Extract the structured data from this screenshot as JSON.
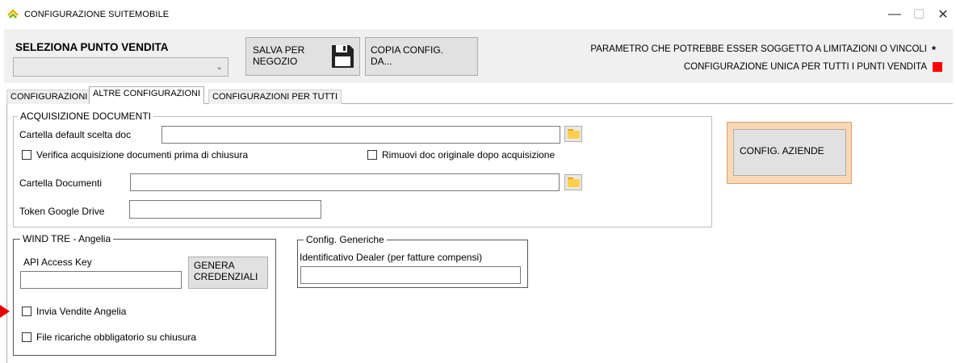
{
  "window": {
    "title": "CONFIGURAZIONE SUITEMOBILE",
    "minimize": "—",
    "maximize": "☐",
    "close": "✕"
  },
  "header": {
    "store_label": "SELEZIONA PUNTO VENDITA",
    "store_value": "",
    "save_label": "SALVA PER\nNEGOZIO",
    "copy_label": "COPIA CONFIG.\nDA...",
    "param_note": "PARAMETRO CHE POTREBBE ESSER SOGGETTO A LIMITAZIONI O VINCOLI",
    "param_mark": "*",
    "unique_note": "CONFIGURAZIONE UNICA PER TUTTI I PUNTI VENDITA"
  },
  "tabs": [
    {
      "label": "CONFIGURAZIONI"
    },
    {
      "label": "ALTRE CONFIGURAZIONI",
      "active": true
    },
    {
      "label": "CONFIGURAZIONI PER TUTTI"
    }
  ],
  "documenti": {
    "title": "ACQUISIZIONE DOCUMENTI",
    "cartella_default_label": "Cartella default scelta doc",
    "cartella_default_value": "",
    "verifica_label": "Verifica acquisizione documenti prima di chiusura",
    "verifica_checked": false,
    "rimuovi_label": "Rimuovi doc originale dopo acquisizione",
    "rimuovi_checked": false,
    "cartella_documenti_label": "Cartella Documenti",
    "cartella_documenti_value": "",
    "token_label": "Token Google Drive",
    "token_value": ""
  },
  "aziende": {
    "button_label": "CONFIG. AZIENDE"
  },
  "wind": {
    "title": "WIND TRE - Angelia",
    "api_label": "API Access Key",
    "api_value": "",
    "genera_label": "GENERA\nCREDENZIALI",
    "invia_label": "Invia Vendite Angelia",
    "invia_checked": false,
    "ricariche_label": "File ricariche obbligatorio su chiusura",
    "ricariche_checked": false
  },
  "generiche": {
    "title": "Config. Generiche",
    "dealer_label": "Identificativo Dealer (per fatture compensi)",
    "dealer_value": ""
  },
  "colors": {
    "accent_red": "#ff0000",
    "aziende_frame": "#fbd8b4"
  }
}
